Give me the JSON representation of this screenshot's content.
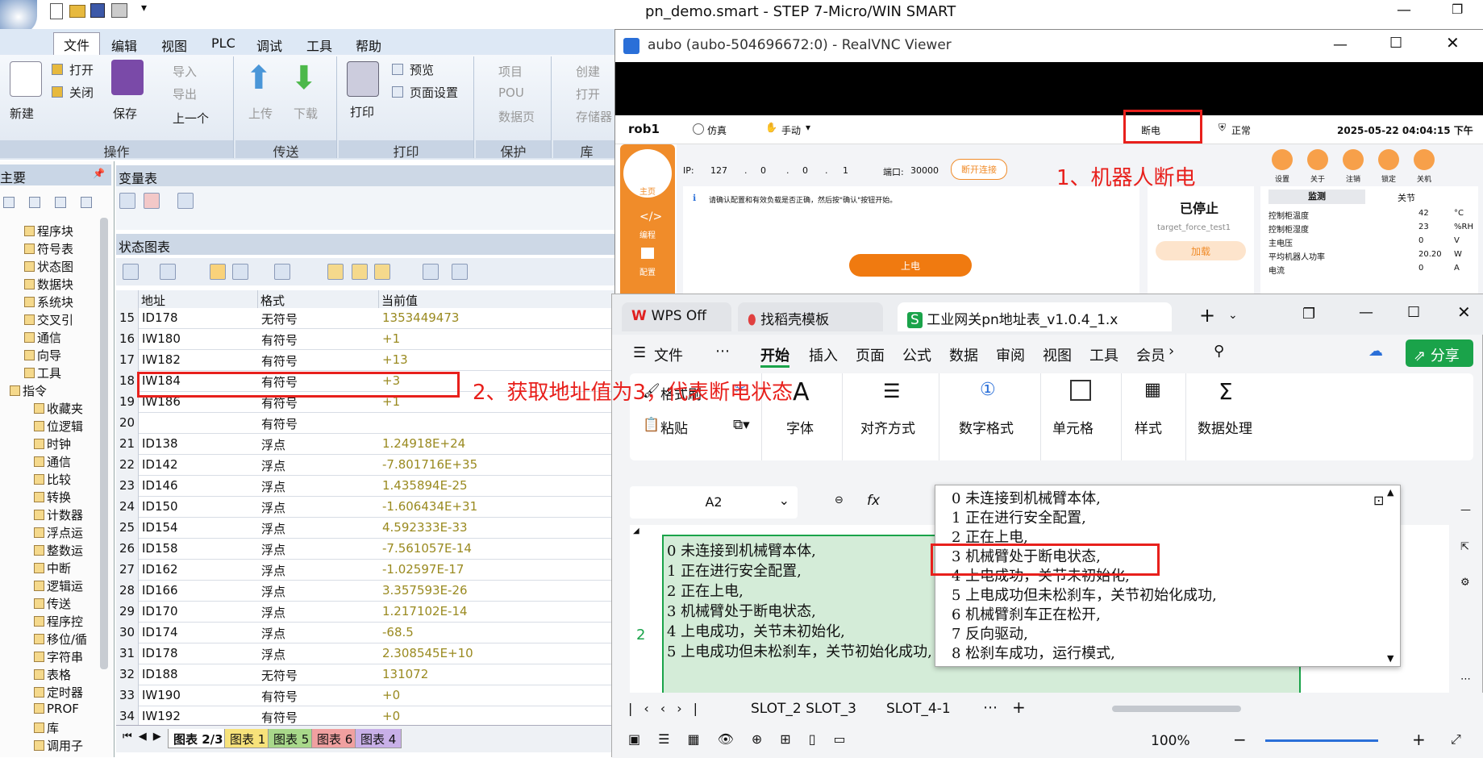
{
  "step7": {
    "title": "pn_demo.smart - STEP 7-Micro/WIN SMART",
    "menu": [
      "文件",
      "编辑",
      "视图",
      "PLC",
      "调试",
      "工具",
      "帮助"
    ],
    "ribbon": {
      "new": "新建",
      "open": "打开",
      "close": "关闭",
      "save": "保存",
      "import": "导入",
      "export": "导出",
      "prev": "上一个",
      "upload": "上传",
      "download": "下载",
      "print": "打印",
      "preview": "预览",
      "page_setup": "页面设置",
      "project": "项目",
      "pou": "POU",
      "datapage": "数据页",
      "create": "创建",
      "open_in": "打开",
      "storage": "存储器",
      "group_ops": "操作",
      "group_transfer": "传送",
      "group_print": "打印",
      "group_protect": "保护",
      "group_lib": "库"
    },
    "tree": {
      "header": "主要",
      "items": [
        "程序块",
        "符号表",
        "状态图",
        "数据块",
        "系统块",
        "交叉引",
        "通信",
        "向导",
        "工具",
        "指令",
        "收藏夹",
        "位逻辑",
        "时钟",
        "通信",
        "比较",
        "转换",
        "计数器",
        "浮点运",
        "整数运",
        "中断",
        "逻辑运",
        "传送",
        "程序控",
        "移位/循",
        "字符串",
        "表格",
        "定时器",
        "PROF",
        "库",
        "调用子"
      ]
    },
    "var_table": {
      "title": "变量表"
    },
    "status_chart": {
      "title": "状态图表",
      "columns": [
        "地址",
        "格式",
        "当前值"
      ],
      "rows": [
        [
          "15",
          "ID178",
          "无符号",
          "1353449473"
        ],
        [
          "16",
          "IW180",
          "有符号",
          "+1"
        ],
        [
          "17",
          "IW182",
          "有符号",
          "+13"
        ],
        [
          "18",
          "IW184",
          "有符号",
          "+3"
        ],
        [
          "19",
          "IW186",
          "有符号",
          "+1"
        ],
        [
          "20",
          "",
          "有符号",
          ""
        ],
        [
          "21",
          "ID138",
          "浮点",
          "1.24918E+24"
        ],
        [
          "22",
          "ID142",
          "浮点",
          "-7.801716E+35"
        ],
        [
          "23",
          "ID146",
          "浮点",
          "1.435894E-25"
        ],
        [
          "24",
          "ID150",
          "浮点",
          "-1.606434E+31"
        ],
        [
          "25",
          "ID154",
          "浮点",
          "4.592333E-33"
        ],
        [
          "26",
          "ID158",
          "浮点",
          "-7.561057E-14"
        ],
        [
          "27",
          "ID162",
          "浮点",
          "-1.02597E-17"
        ],
        [
          "28",
          "ID166",
          "浮点",
          "3.357593E-26"
        ],
        [
          "29",
          "ID170",
          "浮点",
          "1.217102E-14"
        ],
        [
          "30",
          "ID174",
          "浮点",
          "-68.5"
        ],
        [
          "31",
          "ID178",
          "浮点",
          "2.308545E+10"
        ],
        [
          "32",
          "ID188",
          "无符号",
          "131072"
        ],
        [
          "33",
          "IW190",
          "有符号",
          "+0"
        ],
        [
          "34",
          "IW192",
          "有符号",
          "+0"
        ]
      ],
      "tabs": [
        "图表 2/3",
        "图表 1",
        "图表 5",
        "图表 6",
        "图表 4"
      ]
    }
  },
  "vnc": {
    "title": "aubo (aubo-504696672:0) - RealVNC Viewer",
    "robot": "rob1",
    "sim": "仿真",
    "manual": "手动",
    "power_off": "断电",
    "normal": "正常",
    "datetime": "2025-05-22 04:04:15 下午",
    "ip_label": "IP:",
    "ip": [
      "127",
      ".",
      "0",
      ".",
      "0",
      ".",
      "1"
    ],
    "port_label": "端口:",
    "port": "30000",
    "disconnect": "断开连接",
    "notice": "请确认配置和有效负载是否正确，然后按\"确认\"按钮开始。",
    "power_on": "上电",
    "stopped": "已停止",
    "program": "target_force_test1",
    "load": "加载",
    "side": [
      "主页",
      "编程",
      "配置"
    ],
    "top_icons": [
      "设置",
      "关于",
      "注销",
      "锁定",
      "关机"
    ],
    "monitor_tabs": [
      "监测",
      "关节"
    ],
    "monitor": [
      [
        "控制柜温度",
        "42",
        "°C"
      ],
      [
        "控制柜湿度",
        "23",
        "%RH"
      ],
      [
        "主电压",
        "0",
        "V"
      ],
      [
        "平均机器人功率",
        "20.20",
        "W"
      ],
      [
        "电流",
        "0",
        "A"
      ]
    ]
  },
  "wps": {
    "tabs": [
      "WPS Off",
      "找稻壳模板",
      "工业网关pn地址表_v1.0.4_1.x"
    ],
    "menu": [
      "文件",
      "开始",
      "插入",
      "页面",
      "公式",
      "数据",
      "审阅",
      "视图",
      "工具",
      "会员"
    ],
    "share": "分享",
    "ribbon": [
      "格式刷",
      "粘贴",
      "字体",
      "对齐方式",
      "数字格式",
      "单元格",
      "样式",
      "数据处理"
    ],
    "cell_ref": "A2",
    "fx": "fx",
    "cell_lines": [
      "0 未连接到机械臂本体,",
      "1 正在进行安全配置,",
      "2 正在上电,",
      "3 机械臂处于断电状态,",
      "4 上电成功，关节未初始化,",
      "5 上电成功但未松刹车，关节初始化成功,"
    ],
    "row_num": "2",
    "dropdown_lines": [
      "0 未连接到机械臂本体,",
      "1 正在进行安全配置,",
      "2 正在上电,",
      "3 机械臂处于断电状态,",
      "4 上电成功，关节未初始化,",
      "5 上电成功但未松刹车，关节初始化成功,",
      "6 机械臂刹车正在松开,",
      "7 反向驱动,",
      "8 松刹车成功，运行模式,"
    ],
    "sheet_tabs": [
      "SLOT_2 SLOT_3",
      "SLOT_4-1"
    ],
    "zoom": "100%"
  },
  "annotations": {
    "a1": "1、机器人断电",
    "a2": "2、获取地址值为3，代表断电状态"
  },
  "colors": {
    "accent_red": "#e8201c",
    "wps_green": "#1aa34a",
    "robot_orange": "#f08c2a"
  }
}
